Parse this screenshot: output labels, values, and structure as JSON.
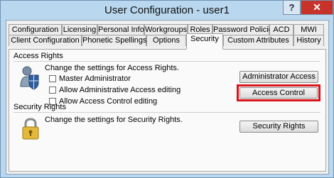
{
  "window": {
    "title": "User Configuration - user1",
    "help_label": "?",
    "close_label": "✕"
  },
  "tabs_row1": [
    "Configuration",
    "Licensing",
    "Personal Info",
    "Workgroups",
    "Roles",
    "Password Policies",
    "ACD",
    "MWI"
  ],
  "tabs_row2": [
    "Client Configuration",
    "Phonetic Spellings",
    "Options",
    "Security",
    "Custom Attributes",
    "History"
  ],
  "active_tab": "Security",
  "access_rights": {
    "title": "Access Rights",
    "description": "Change the settings for Access Rights.",
    "checkboxes": [
      {
        "label": "Master Administrator",
        "checked": false
      },
      {
        "label": "Allow Administrative Access editing",
        "checked": false
      },
      {
        "label": "Allow Access Control editing",
        "checked": false
      }
    ],
    "admin_button": "Administrator Access",
    "access_control_button": "Access Control",
    "icon": "shield-user-icon"
  },
  "security_rights": {
    "title": "Security Rights",
    "description": "Change the settings for Security Rights.",
    "button": "Security Rights",
    "icon": "padlock-icon"
  },
  "colors": {
    "highlight": "#d8141c",
    "titlebar": "#b9d7ee",
    "close": "#c7332b"
  }
}
